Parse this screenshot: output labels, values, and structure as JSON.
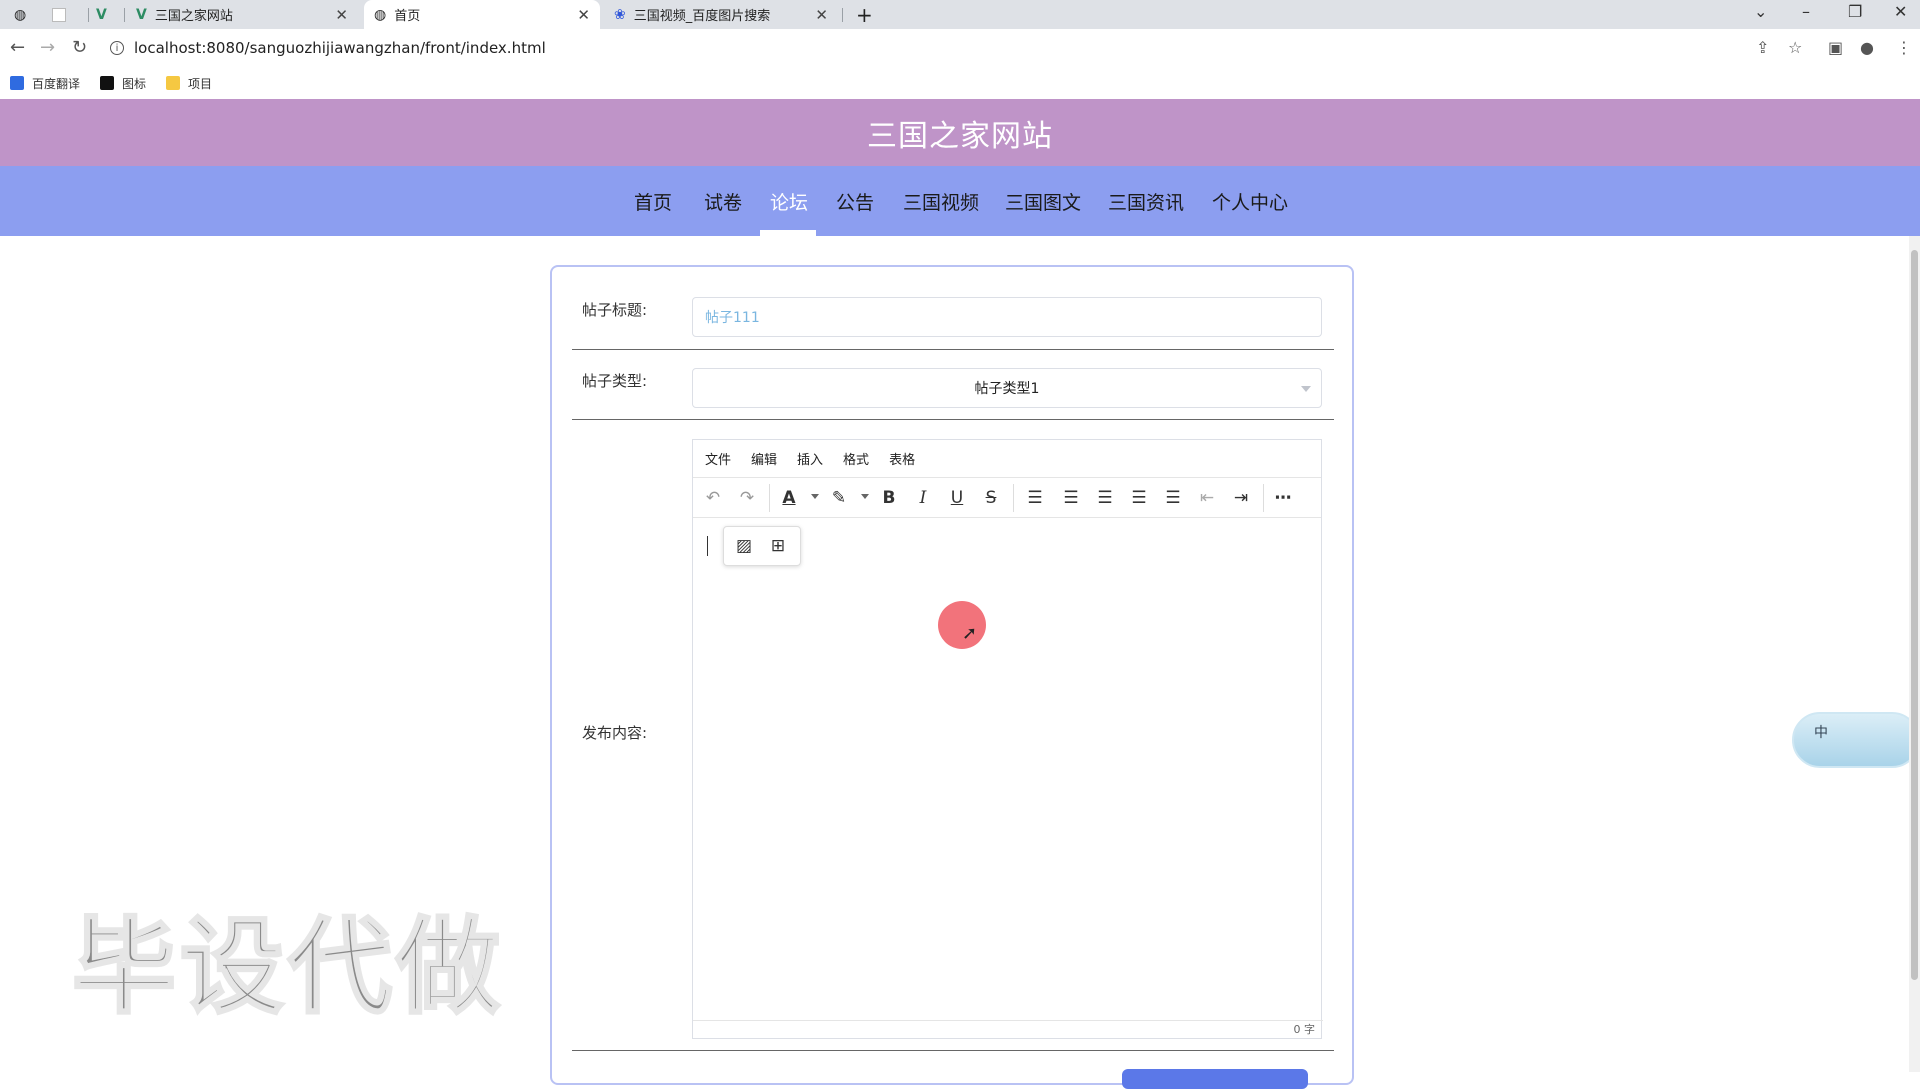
{
  "browser": {
    "tabs": [
      {
        "title": "三国之家网站",
        "active": false
      },
      {
        "title": "首页",
        "active": true
      },
      {
        "title": "三国视频_百度图片搜索",
        "active": false
      }
    ],
    "url": "localhost:8080/sanguozhijiawangzhan/front/index.html",
    "bookmarks": [
      "百度翻译",
      "图标",
      "项目"
    ]
  },
  "site": {
    "title": "三国之家网站",
    "nav": [
      "首页",
      "试卷",
      "论坛",
      "公告",
      "三国视频",
      "三国图文",
      "三国资讯",
      "个人中心"
    ],
    "active_nav": "论坛"
  },
  "form": {
    "title_label": "帖子标题:",
    "title_value": "帖子111",
    "type_label": "帖子类型:",
    "type_value": "帖子类型1",
    "content_label": "发布内容:",
    "editor_menu": [
      "文件",
      "编辑",
      "插入",
      "格式",
      "表格"
    ],
    "word_count": "0 字"
  },
  "overlay": {
    "watermark": "毕设代做",
    "ime_text": "中"
  },
  "colors": {
    "header_bg": "#bf94c8",
    "nav_bg": "#8c9ef0",
    "card_border": "#b9c2f4",
    "submit_button": "#5b78e8"
  }
}
